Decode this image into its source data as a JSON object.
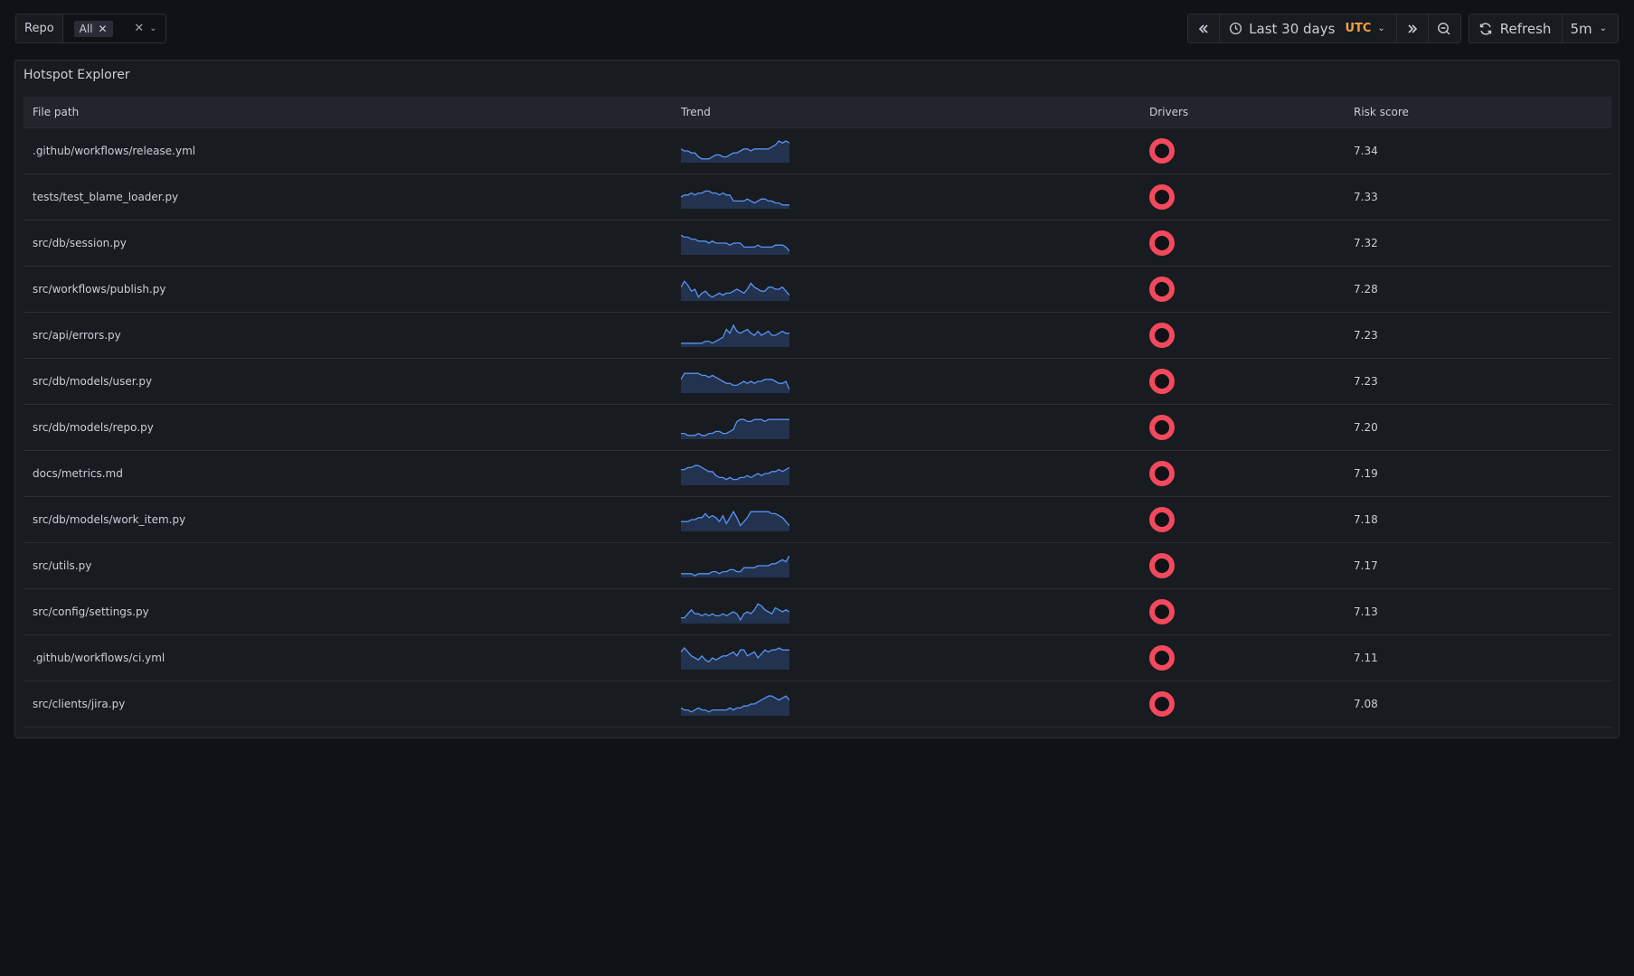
{
  "variables": {
    "repo_label": "Repo",
    "repo_value": "All"
  },
  "time_picker": {
    "range_label": "Last 30 days",
    "timezone": "UTC",
    "refresh_label": "Refresh",
    "interval": "5m"
  },
  "panel": {
    "title": "Hotspot Explorer",
    "columns": [
      "File path",
      "Trend",
      "Drivers",
      "Risk score"
    ],
    "colors": {
      "spark_line": "#5794f2",
      "spark_fill": "#22324f",
      "driver_ring": "#f2495c"
    },
    "rows": [
      {
        "path": ".github/workflows/release.yml",
        "risk": "7.34",
        "trend": [
          6,
          5,
          5,
          4,
          4,
          2,
          1,
          1,
          1,
          2,
          3,
          3,
          2,
          2,
          3,
          4,
          4,
          5,
          6,
          6,
          5,
          6,
          6,
          6,
          6,
          6,
          7,
          8,
          10,
          9,
          10,
          9
        ]
      },
      {
        "path": "tests/test_blame_loader.py",
        "risk": "7.33",
        "trend": [
          5,
          6,
          6,
          7,
          6,
          7,
          7,
          8,
          8,
          7,
          7,
          6,
          7,
          6,
          6,
          3,
          3,
          3,
          3,
          4,
          3,
          2,
          3,
          4,
          4,
          3,
          3,
          2,
          2,
          1,
          1,
          1
        ]
      },
      {
        "path": "src/db/session.py",
        "risk": "7.32",
        "trend": [
          9,
          8,
          8,
          7,
          7,
          6,
          6,
          6,
          5,
          6,
          5,
          5,
          5,
          5,
          4,
          5,
          5,
          5,
          3,
          3,
          3,
          3,
          4,
          3,
          3,
          3,
          3,
          4,
          4,
          4,
          3,
          1
        ]
      },
      {
        "path": "src/workflows/publish.py",
        "risk": "7.28",
        "trend": [
          6,
          9,
          7,
          4,
          5,
          1,
          3,
          4,
          2,
          1,
          2,
          3,
          2,
          3,
          3,
          4,
          5,
          4,
          3,
          5,
          8,
          6,
          5,
          4,
          4,
          6,
          6,
          5,
          5,
          6,
          4,
          2
        ]
      },
      {
        "path": "src/api/errors.py",
        "risk": "7.23",
        "trend": [
          1,
          1,
          1,
          1,
          1,
          1,
          1,
          2,
          2,
          1,
          2,
          3,
          4,
          8,
          6,
          10,
          7,
          6,
          7,
          8,
          6,
          5,
          7,
          5,
          6,
          7,
          5,
          5,
          6,
          7,
          6,
          6
        ]
      },
      {
        "path": "src/db/models/user.py",
        "risk": "7.23",
        "trend": [
          6,
          9,
          9,
          9,
          9,
          9,
          8,
          8,
          7,
          8,
          7,
          6,
          5,
          4,
          4,
          3,
          3,
          4,
          5,
          4,
          5,
          4,
          5,
          5,
          6,
          6,
          6,
          5,
          4,
          4,
          5,
          1
        ]
      },
      {
        "path": "src/db/models/repo.py",
        "risk": "7.20",
        "trend": [
          2,
          2,
          1,
          1,
          1,
          2,
          1,
          1,
          2,
          2,
          3,
          3,
          2,
          2,
          3,
          4,
          8,
          9,
          9,
          8,
          8,
          9,
          9,
          9,
          8,
          9,
          9,
          9,
          9,
          9,
          9,
          9
        ]
      },
      {
        "path": "docs/metrics.md",
        "risk": "7.19",
        "trend": [
          7,
          7,
          8,
          8,
          9,
          9,
          8,
          7,
          6,
          6,
          4,
          3,
          3,
          2,
          3,
          2,
          2,
          3,
          3,
          4,
          3,
          4,
          5,
          4,
          5,
          5,
          6,
          6,
          7,
          6,
          7,
          8
        ]
      },
      {
        "path": "src/db/models/work_item.py",
        "risk": "7.18",
        "trend": [
          4,
          4,
          4,
          5,
          5,
          6,
          6,
          8,
          6,
          7,
          6,
          4,
          7,
          3,
          6,
          9,
          6,
          2,
          4,
          6,
          9,
          9,
          9,
          9,
          9,
          9,
          8,
          8,
          7,
          6,
          4,
          2
        ]
      },
      {
        "path": "src/utils.py",
        "risk": "7.17",
        "trend": [
          1,
          1,
          1,
          1,
          0,
          1,
          1,
          1,
          1,
          2,
          2,
          1,
          2,
          2,
          3,
          3,
          2,
          2,
          4,
          4,
          4,
          4,
          5,
          5,
          5,
          5,
          6,
          6,
          7,
          8,
          7,
          10
        ]
      },
      {
        "path": "src/config/settings.py",
        "risk": "7.13",
        "trend": [
          2,
          2,
          4,
          6,
          4,
          4,
          3,
          4,
          3,
          4,
          3,
          3,
          4,
          3,
          4,
          5,
          4,
          1,
          4,
          5,
          4,
          6,
          9,
          8,
          6,
          5,
          4,
          7,
          6,
          5,
          6,
          5
        ]
      },
      {
        "path": ".github/workflows/ci.yml",
        "risk": "7.11",
        "trend": [
          8,
          10,
          8,
          6,
          5,
          4,
          6,
          4,
          3,
          5,
          4,
          5,
          6,
          6,
          7,
          8,
          6,
          9,
          9,
          6,
          7,
          8,
          5,
          7,
          9,
          8,
          9,
          9,
          10,
          9,
          9,
          9
        ]
      },
      {
        "path": "src/clients/jira.py",
        "risk": "7.08",
        "trend": [
          3,
          2,
          2,
          1,
          2,
          3,
          2,
          2,
          1,
          2,
          2,
          2,
          2,
          2,
          3,
          2,
          3,
          3,
          4,
          4,
          5,
          5,
          6,
          7,
          8,
          9,
          9,
          8,
          7,
          8,
          9,
          7
        ]
      }
    ]
  }
}
